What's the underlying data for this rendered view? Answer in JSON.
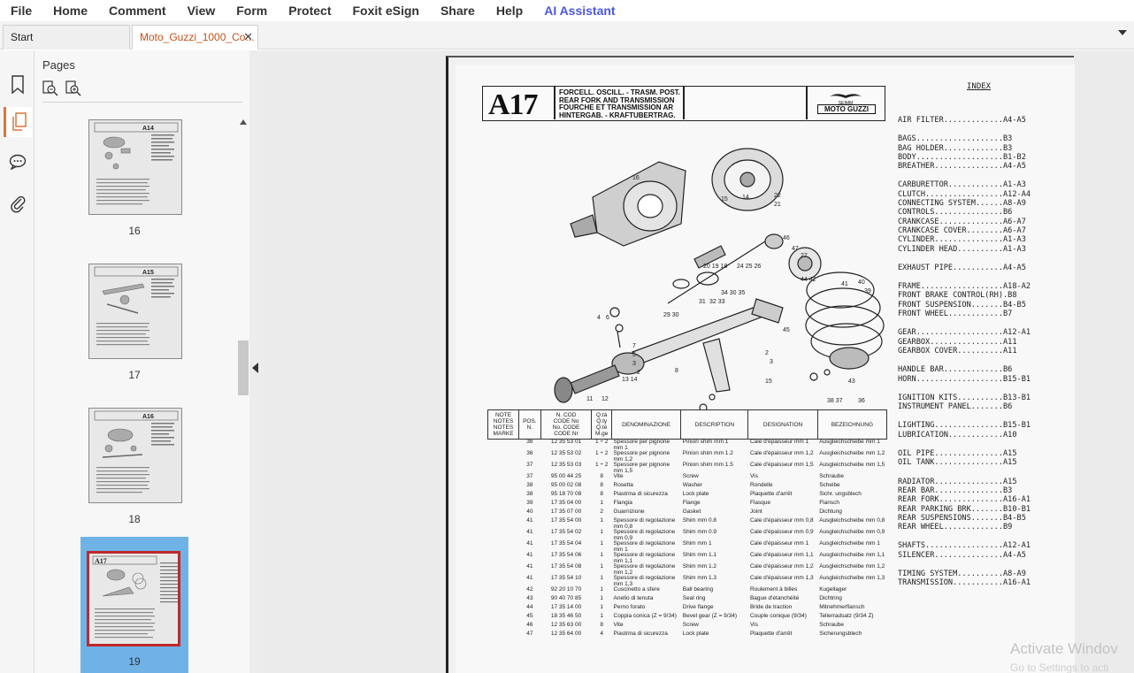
{
  "menu": {
    "items": [
      "File",
      "Home",
      "Comment",
      "View",
      "Form",
      "Protect",
      "Foxit eSign",
      "Share",
      "Help"
    ],
    "ai_label": "AI Assistant",
    "ai_color": "#4a56e2"
  },
  "tabs": {
    "start_label": "Start",
    "doc_label": "Moto_Guzzi_1000_Co...",
    "close_glyph": "✕"
  },
  "sidebar": {
    "title": "Pages",
    "icons": [
      "bookmark-icon",
      "pages-icon",
      "comment-icon",
      "attachment-icon"
    ]
  },
  "thumbnails": [
    {
      "page": "16",
      "code": "A14"
    },
    {
      "page": "17",
      "code": "A15"
    },
    {
      "page": "18",
      "code": "A16"
    },
    {
      "page": "19",
      "code": "A17",
      "selected": true
    }
  ],
  "document": {
    "code": "A17",
    "title_lines": [
      "FORCELL. OSCILL. - TRASM. POST.",
      "REAR FORK AND TRANSMISSION",
      "FOURCHE ET TRANSMISSION AR",
      "HINTERGAB. - KRAFTUBERTRAG."
    ],
    "brand_small": "SEIMM",
    "brand": "MOTO GUZZI",
    "table_headers": [
      "NOTE\nNOTES\nNOTES\nMARKE",
      "POS.\nN.",
      "N. COD\nCODE No\nNo. CODE\nCODE Nr",
      "Q.tà\nQ.ty\nQ.té\nM.ge",
      "DENOMINAZIONE",
      "DESCRIPTION",
      "DESIGNATION",
      "BEZEICHNUNG"
    ],
    "rows": [
      [
        "",
        "36",
        "12 35 53 01",
        "1 ÷ 2",
        "Spessore per pignone mm 1",
        "Pinion shim mm 1",
        "Cale d'épaisseur mm 1",
        "Ausgleichscheibe mm 1"
      ],
      [
        "",
        "36",
        "12 35 53 02",
        "1 ÷ 2",
        "Spessore per pignone mm 1,2",
        "Pinion shim mm 1.2",
        "Cale d'épaisseur mm 1,2",
        "Ausgleichscheibe mm 1,2"
      ],
      [
        "",
        "37",
        "12 35 53 03",
        "1 ÷ 2",
        "Spessore per pignone mm 1,5",
        "Pinion shim mm 1.5",
        "Cale d'épaisseur mm 1,5",
        "Ausgleichscheibe mm 1,5"
      ],
      [
        "",
        "37",
        "95 00 44 25",
        "8",
        "Vite",
        "Screw",
        "Vis",
        "Schraube"
      ],
      [
        "",
        "38",
        "95 00 02 08",
        "8",
        "Rosetta",
        "Washer",
        "Rondelle",
        "Scheibe"
      ],
      [
        "",
        "38",
        "95 18 70 08",
        "8",
        "Piastrina di sicurezza",
        "Lock plate",
        "Plaquette d'arrêt",
        "Sichr. ungsblech"
      ],
      [
        "",
        "39",
        "17 35 04 00",
        "1",
        "Flangia",
        "Flange",
        "Flasque",
        "Flansch"
      ],
      [
        "",
        "40",
        "17 35 07 00",
        "2",
        "Guarnizione",
        "Gasket",
        "Joint",
        "Dichtung"
      ],
      [
        "",
        "41",
        "17 35 54 00",
        "1",
        "Spessore di regolazione mm 0,8",
        "Shim mm 0.8",
        "Cale d'épaisseur mm 0,8",
        "Ausgleichscheibe mm 0,8"
      ],
      [
        "",
        "41",
        "17 35 54 02",
        "1",
        "Spessore di regolazione mm 0,9",
        "Shim mm 0.9",
        "Cale d'épaisseur mm 0,9",
        "Ausgleichscheibe mm 0,9"
      ],
      [
        "",
        "41",
        "17 35 54 04",
        "1",
        "Spessore di regolazione mm 1",
        "Shim mm 1",
        "Cale d'épaisseur mm 1",
        "Ausgleichscheibe mm 1"
      ],
      [
        "",
        "41",
        "17 35 54 06",
        "1",
        "Spessore di regolazione mm 1,1",
        "Shim mm 1.1",
        "Cale d'épaisseur mm 1,1",
        "Ausgleichscheibe mm 1,1"
      ],
      [
        "",
        "41",
        "17 35 54 08",
        "1",
        "Spessore di regolazione mm 1,2",
        "Shim mm 1.2",
        "Cale d'épaisseur mm 1,2",
        "Ausgleichscheibe mm 1,2"
      ],
      [
        "",
        "41",
        "17 35 54 10",
        "1",
        "Spessore di regolazione mm 1,3",
        "Shim mm 1.3",
        "Cale d'épaisseur mm 1,3",
        "Ausgleichscheibe mm 1,3"
      ],
      [
        "",
        "42",
        "92 20 10 70",
        "1",
        "Cuscinetto a sfere",
        "Ball bearing",
        "Roulement à billes",
        "Kugellager"
      ],
      [
        "",
        "43",
        "90 40 70 85",
        "1",
        "Anello di tenuta",
        "Seal ring",
        "Bague d'étanchéité",
        "Dichtring"
      ],
      [
        "",
        "44",
        "17 35 14 00",
        "1",
        "Perno forato",
        "Drive flange",
        "Bride de traction",
        "Mitnehmerflansch"
      ],
      [
        "",
        "45",
        "18 35 46 50",
        "1",
        "Coppia conica (Z = 9/34)",
        "Bevel gear (Z = 9/34)",
        "Couple conique (9/34)",
        "Tellerradsatz (9/34 Z)"
      ],
      [
        "",
        "46",
        "12 35 63 00",
        "8",
        "Vite",
        "Screw",
        "Vis",
        "Schraube"
      ],
      [
        "",
        "47",
        "12 35 64 00",
        "4",
        "Piastrina di sicurezza",
        "Lock plate",
        "Plaquette d'arrêt",
        "Sicherungsblech"
      ]
    ],
    "index_title": "INDEX",
    "index_groups": [
      [
        "AIR FILTER.............A4-A5"
      ],
      [
        "BAGS...................B3",
        "BAG HOLDER.............B3",
        "BODY...................B1-B2",
        "BREATHER...............A4-A5"
      ],
      [
        "CARBURETTOR............A1-A3",
        "CLUTCH.................A12-A4",
        "CONNECTING SYSTEM......A8-A9",
        "CONTROLS...............B6",
        "CRANKCASE..............A6-A7",
        "CRANKCASE COVER........A6-A7",
        "CYLINDER...............A1-A3",
        "CYLINDER HEAD..........A1-A3"
      ],
      [
        "EXHAUST PIPE...........A4-A5"
      ],
      [
        "FRAME..................A18-A2",
        "FRONT BRAKE CONTROL(RH).B8",
        "FRONT SUSPENSION.......B4-B5",
        "FRONT WHEEL............B7"
      ],
      [
        "GEAR...................A12-A1",
        "GEARBOX................A11",
        "GEARBOX COVER..........A11"
      ],
      [
        "HANDLE BAR.............B6",
        "HORN...................B15-B1"
      ],
      [
        "IGNITION KITS..........B13-B1",
        "INSTRUMENT PANEL.......B6"
      ],
      [
        "LIGHTING...............B15-B1",
        "LUBRICATION............A10"
      ],
      [
        "OIL PIPE...............A15",
        "OIL TANK...............A15"
      ],
      [
        "RADIATOR...............A15",
        "REAR BAR...............B3",
        "REAR FORK..............A16-A1",
        "REAR PARKING BRK.......B10-B1",
        "REAR SUSPENSIONS.......B4-B5",
        "REAR WHEEL.............B9"
      ],
      [
        "SHAFTS.................A12-A1",
        "SILENCER...............A4-A5"
      ],
      [
        "TIMING SYSTEM..........A8-A9",
        "TRANSMISSION...........A16-A1"
      ]
    ]
  },
  "watermark": {
    "line1": "Activate Windov",
    "line2": "Go to Settings to acti"
  }
}
